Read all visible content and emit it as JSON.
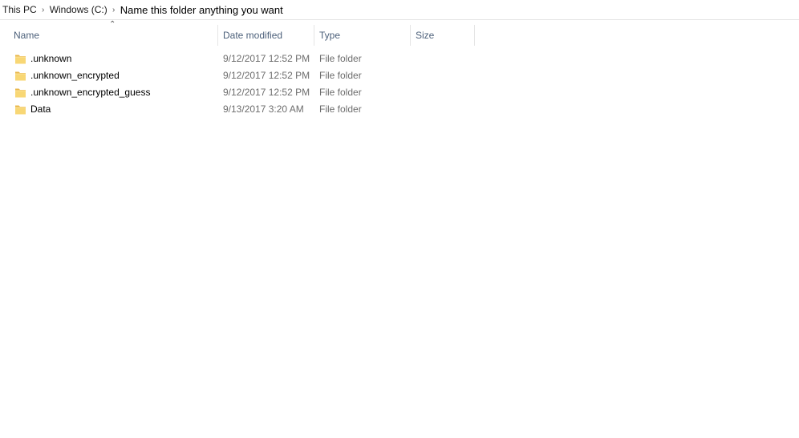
{
  "breadcrumb": {
    "items": [
      {
        "label": "This PC"
      },
      {
        "label": "Windows (C:)"
      },
      {
        "label": "Name this folder anything you want"
      }
    ],
    "separator_icon": "chevron-right-icon"
  },
  "columns": {
    "name": "Name",
    "date": "Date modified",
    "type": "Type",
    "size": "Size",
    "sort_indicator_icon": "sort-ascending-icon"
  },
  "files": [
    {
      "name": ".unknown",
      "date": "9/12/2017 12:52 PM",
      "type": "File folder",
      "size": "",
      "icon": "folder-icon"
    },
    {
      "name": ".unknown_encrypted",
      "date": "9/12/2017 12:52 PM",
      "type": "File folder",
      "size": "",
      "icon": "folder-icon"
    },
    {
      "name": ".unknown_encrypted_guess",
      "date": "9/12/2017 12:52 PM",
      "type": "File folder",
      "size": "",
      "icon": "folder-icon"
    },
    {
      "name": "Data",
      "date": "9/13/2017 3:20 AM",
      "type": "File folder",
      "size": "",
      "icon": "folder-icon"
    }
  ],
  "colors": {
    "folder_fill": "#f8d775",
    "folder_back": "#e8b74a",
    "header_text": "#4c607a",
    "meta_text": "#6d6d6d"
  }
}
